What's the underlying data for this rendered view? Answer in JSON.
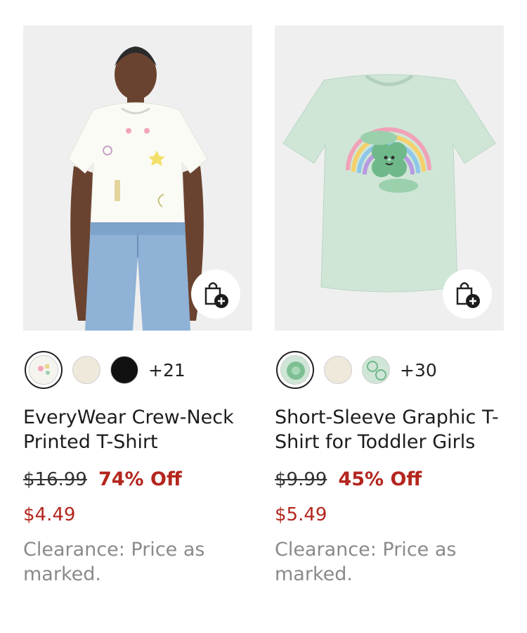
{
  "products": [
    {
      "name": "EveryWear Crew-Neck Printed T-Shirt",
      "more_colors": "+21",
      "original_price": "$16.99",
      "discount": "74% Off",
      "sale_price": "$4.49",
      "clearance_note": "Clearance: Price as marked.",
      "swatch_colors": [
        "#f4f2ea",
        "#efe9dc",
        "#111111"
      ]
    },
    {
      "name": "Short-Sleeve Graphic T-Shirt for Toddler Girls",
      "more_colors": "+30",
      "original_price": "$9.99",
      "discount": "45% Off",
      "sale_price": "$5.49",
      "clearance_note": "Clearance: Price as marked.",
      "swatch_colors": [
        "#cfe6d6",
        "#efe9dc",
        "#cfe6d6"
      ]
    }
  ],
  "colors": {
    "sale_red": "#b3261e",
    "muted_gray": "#8a8a8a"
  },
  "icons": {
    "add_to_bag": "shopping-bag-add-icon"
  }
}
